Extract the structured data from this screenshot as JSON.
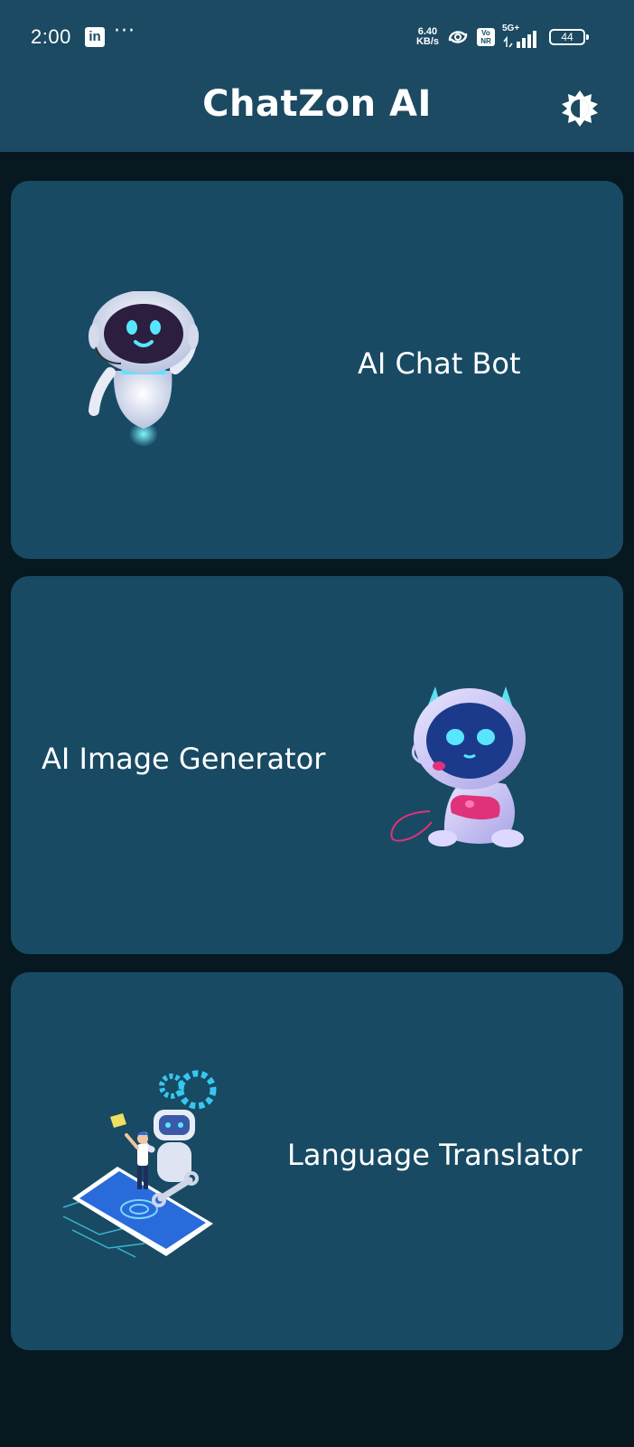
{
  "status_bar": {
    "time": "2:00",
    "linkedin_icon_label": "in",
    "more_dots": "···",
    "net_speed_value": "6.40",
    "net_speed_unit": "KB/s",
    "vonr_line1": "Vo",
    "vonr_line2": "NR",
    "network_type": "5G+",
    "battery_level": "44",
    "icons": [
      "linkedin-icon",
      "more-icon",
      "hotspot-icon",
      "vonr-icon",
      "signal-icon",
      "battery-icon"
    ]
  },
  "app_bar": {
    "title": "ChatZon AI",
    "theme_icon": "brightness-icon"
  },
  "cards": [
    {
      "label": "AI Chat Bot",
      "illustration": "robot-waving"
    },
    {
      "label": "AI Image Generator",
      "illustration": "robot-gamer"
    },
    {
      "label": "Language Translator",
      "illustration": "person-robot-phone"
    }
  ],
  "colors": {
    "background": "#071821",
    "app_bar": "#1b4a62",
    "card": "#184a63",
    "text": "#ffffff"
  }
}
